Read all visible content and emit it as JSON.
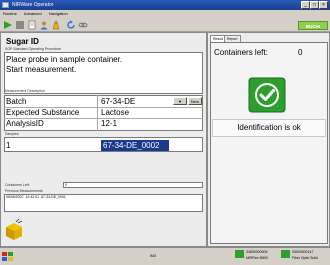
{
  "window": {
    "title": "NIRWare Operator"
  },
  "menu": [
    "Routine",
    "Advanced",
    "Navigation"
  ],
  "brand": {
    "label": "BUCHI"
  },
  "header": {
    "title": "Sugar ID"
  },
  "sop": {
    "label": "SOP Standard Operating Procedure",
    "lines": [
      "Place probe in sample container.",
      "Start measurement."
    ]
  },
  "measurement": {
    "section_label": "Measurement Description",
    "fields": [
      {
        "label": "Batch",
        "value": "67-34-DE"
      },
      {
        "label": "Expected Substance",
        "value": "Lactose"
      },
      {
        "label": "AnalysisID",
        "value": "12-1"
      }
    ],
    "new_button": "New"
  },
  "samples": {
    "section_label": "Samples",
    "rows": [
      {
        "index": "1",
        "name": "67-34-DE_0002"
      }
    ]
  },
  "containers": {
    "label": "Containers Left:",
    "value": "0"
  },
  "previous": {
    "label": "Previous Measurements",
    "rows": [
      {
        "date": "05/05/2007",
        "time": "12:42:01",
        "name": "67-34-DE_0001"
      }
    ]
  },
  "right": {
    "tabs": [
      "Result",
      "Report"
    ],
    "containers_left_label": "Containers left:",
    "containers_left_value": "0",
    "result_text": "Identification is ok"
  },
  "status": {
    "center": "IM3",
    "device1": {
      "id": "34830000009",
      "name": "NIRFlex N500"
    },
    "device2": {
      "id": "05000000147",
      "name": "Fiber Optic Solid"
    }
  },
  "colors": {
    "ok_green": "#2e9e2e",
    "selection": "#1a3a8c",
    "titlebar": "#1a3f92"
  }
}
